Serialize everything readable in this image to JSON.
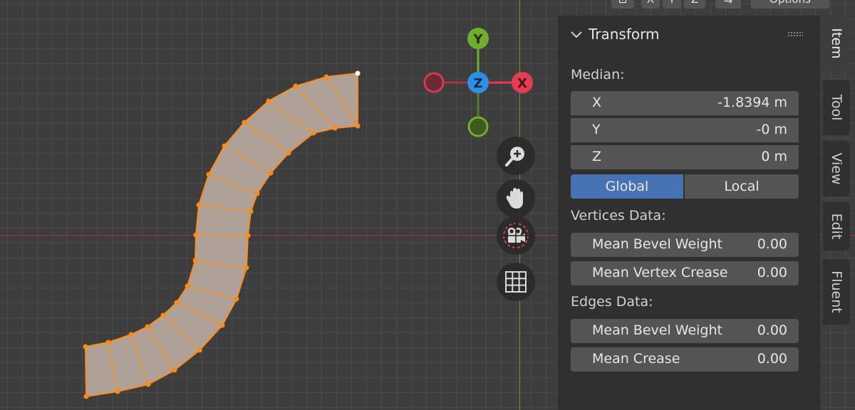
{
  "header": {
    "partial_buttons": [
      "X",
      "Y",
      "Z"
    ],
    "options_label": "Options"
  },
  "gizmo": {
    "y_label": "Y",
    "z_label": "Z",
    "x_label": "X",
    "colors": {
      "x": "#e43d51",
      "y": "#6fad2c",
      "z": "#2f8ee6"
    }
  },
  "nav": [
    "zoom-icon",
    "hand-icon",
    "camera-icon",
    "grid-icon"
  ],
  "panel": {
    "title": "Transform",
    "median_label": "Median:",
    "median": [
      {
        "label": "X",
        "value": "-1.8394 m"
      },
      {
        "label": "Y",
        "value": "-0 m"
      },
      {
        "label": "Z",
        "value": "0 m"
      }
    ],
    "space": {
      "global": "Global",
      "local": "Local",
      "active": "Global"
    },
    "vertices_label": "Vertices Data:",
    "vertices": [
      {
        "label": "Mean Bevel Weight",
        "value": "0.00"
      },
      {
        "label": "Mean Vertex Crease",
        "value": "0.00"
      }
    ],
    "edges_label": "Edges Data:",
    "edges": [
      {
        "label": "Mean Bevel Weight",
        "value": "0.00"
      },
      {
        "label": "Mean Crease",
        "value": "0.00"
      }
    ]
  },
  "tabs": [
    {
      "label": "Item",
      "active": true
    },
    {
      "label": "Tool",
      "active": false
    },
    {
      "label": "View",
      "active": false
    },
    {
      "label": "Edit",
      "active": false
    },
    {
      "label": "Fluent",
      "active": false
    }
  ],
  "colors": {
    "mesh_fill": "#b0a197",
    "mesh_edge": "#ff8c1a",
    "accent": "#4772b3",
    "axis_x": "#a8343f",
    "axis_y": "#6f9a2c"
  }
}
